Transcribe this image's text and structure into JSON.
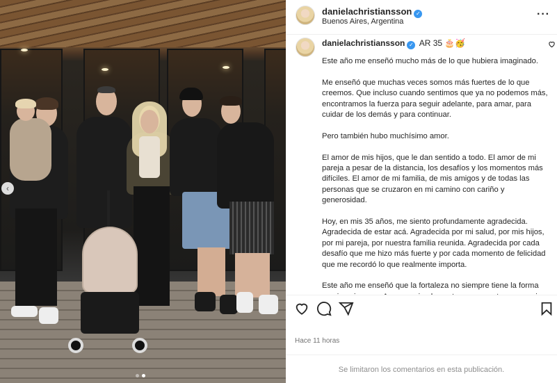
{
  "post": {
    "author": {
      "username": "danielachristiansson",
      "location": "Buenos Aires, Argentina",
      "verified": true
    },
    "caption_header": {
      "username": "danielachristiansson",
      "location_tag": "AR 35",
      "emojis": "🎂🥳"
    },
    "caption": [
      "Este año me enseñó mucho más de lo que hubiera imaginado.",
      "Me enseñó que muchas veces somos más fuertes de lo que creemos. Que incluso cuando sentimos que ya no podemos más, encontramos la fuerza para seguir adelante, para amar, para cuidar de los demás y para continuar.",
      "Pero también hubo muchísimo amor.",
      "El amor de mis hijos, que le dan sentido a todo. El amor de mi pareja a pesar de la distancia, los desafíos y los momentos más difíciles. El amor de mi familia, de mis amigos y de todas las personas que se cruzaron en mi camino con cariño y generosidad.",
      "Hoy, en mis 35 años, me siento profundamente agradecida. Agradecida de estar acá. Agradecida por mi salud, por mis hijos, por mi pareja, por nuestra familia reunida. Agradecida por cada desafío que me hizo más fuerte y por cada momento de felicidad que me recordó lo que realmente importa.",
      "Este año me enseñó que la fortaleza no siempre tiene la forma que imaginamos. A veces, simplemente se encuentra en seguir adelante, un día a la vez, con amor, incluso cuando las cosas"
    ],
    "timestamp": "Hace 11 horas",
    "comments_disabled_text": "Se limitaron los comentarios en esta publicación.",
    "carousel": {
      "current": 2,
      "total": 2
    }
  },
  "icons": {
    "more": "more-options-icon",
    "like": "heart-icon",
    "comment": "comment-icon",
    "share": "share-icon",
    "save": "bookmark-icon",
    "verified": "verified-badge-icon",
    "prev": "chevron-left-icon"
  },
  "colors": {
    "verified": "#3897f0",
    "text": "#262626",
    "muted": "#737373"
  }
}
